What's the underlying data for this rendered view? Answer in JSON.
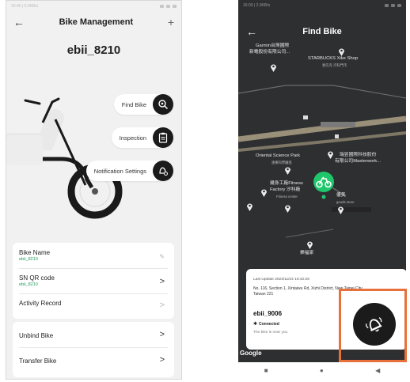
{
  "left": {
    "status_time": "10:46 | 0.0KB/s",
    "title": "Bike Management",
    "add_symbol": "+",
    "bike_name": "ebii_8210",
    "actions": [
      "Find Bike",
      "Inspection",
      "Notification Settings"
    ],
    "info_rows": [
      {
        "label": "Bike Name",
        "sub": "ebii_8210",
        "chevron": "pencil-icon"
      },
      {
        "label": "SN QR code",
        "sub": "ebii_8210",
        "chevron": ">"
      },
      {
        "label": "Activity Record",
        "sub": "",
        "chevron": ">"
      }
    ],
    "account_rows": [
      {
        "label": "Unbind Bike",
        "chevron": ">"
      },
      {
        "label": "Transfer Bike",
        "chevron": ">"
      }
    ]
  },
  "right": {
    "status_time": "16:03 | 2.0KB/s",
    "title": "Find Bike",
    "map_labels": [
      "Garmin台灣國際",
      "新電股份有限公司...",
      "STARBUCKS Xike Shop",
      "星巴克 汐科門市",
      "Oriental Science Park",
      "遠東科學園區",
      "瑞昱國際科技股份",
      "有限公司Masterwork...",
      "健身工廠Fitness",
      "Factory 汐科廠",
      "Fitness center",
      "優美",
      "goods store",
      "樂福家"
    ],
    "last_update": "Last Update 2023/11/24 16:42:26",
    "address": "No. 116, Section 1, Xintaiwu Rd, Xizhi District, New Taipei City, Taiwan 221",
    "device_name": "ebii_9006",
    "connection": "Connected",
    "proximity": "The bike is near you",
    "map_brand": "Google"
  },
  "colors": {
    "accent_green": "#1ec76b",
    "highlight_orange": "#e8703a",
    "dark_button": "#1b1b1b"
  }
}
